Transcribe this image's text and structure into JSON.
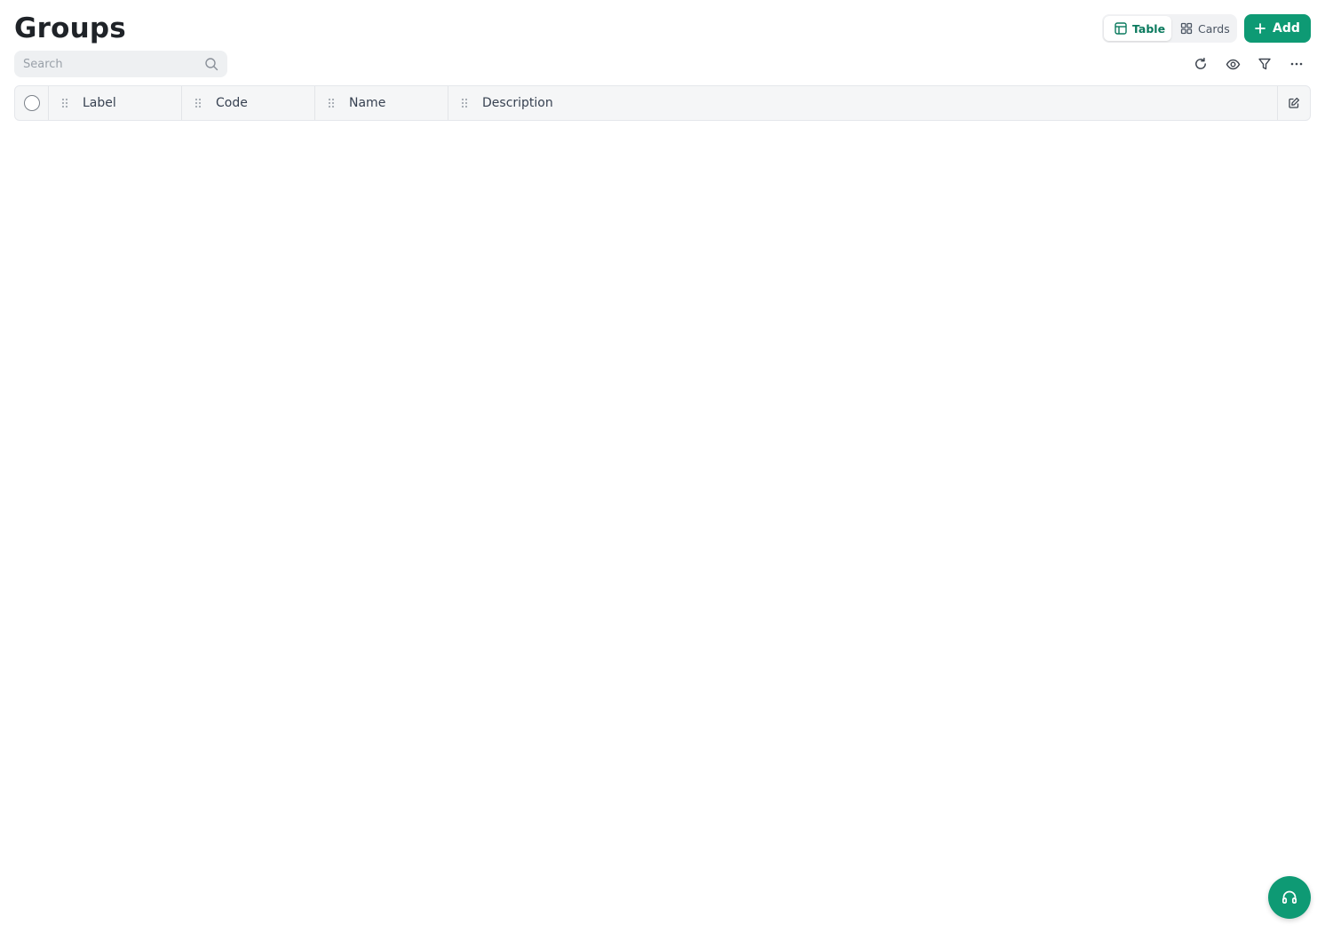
{
  "page": {
    "title": "Groups"
  },
  "view_toggle": {
    "options": [
      {
        "label": "Table",
        "icon": "table-icon",
        "active": true
      },
      {
        "label": "Cards",
        "icon": "grid-icon",
        "active": false
      }
    ]
  },
  "add_button": {
    "label": "Add",
    "icon": "plus-icon"
  },
  "search": {
    "placeholder": "Search",
    "value": ""
  },
  "toolbar": {
    "icons": [
      "refresh-icon",
      "eye-icon",
      "filter-icon",
      "more-icon"
    ]
  },
  "table": {
    "columns": [
      {
        "label": "Label"
      },
      {
        "label": "Code"
      },
      {
        "label": "Name"
      },
      {
        "label": "Description"
      }
    ],
    "rows": []
  },
  "help": {
    "icon": "headset-icon"
  },
  "colors": {
    "accent": "#0e9a74",
    "accent_text": "#0b7a5e",
    "header_bg": "#f5f6f7"
  }
}
